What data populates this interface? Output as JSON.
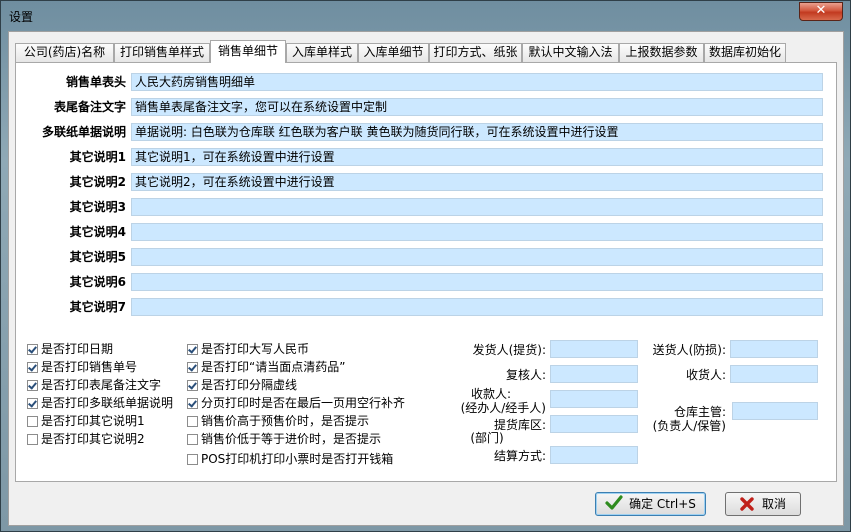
{
  "window": {
    "title": "设置",
    "close_glyph": "✕"
  },
  "tabs": [
    {
      "label": "公司(药店)名称"
    },
    {
      "label": "打印销售单样式"
    },
    {
      "label": "销售单细节"
    },
    {
      "label": "入库单样式"
    },
    {
      "label": "入库单细节"
    },
    {
      "label": "打印方式、纸张"
    },
    {
      "label": "默认中文输入法"
    },
    {
      "label": "上报数据参数"
    },
    {
      "label": "数据库初始化"
    }
  ],
  "fields": [
    {
      "label": "销售单表头",
      "value": "人民大药房销售明细单"
    },
    {
      "label": "表尾备注文字",
      "value": "销售单表尾备注文字，您可以在系统设置中定制"
    },
    {
      "label": "多联纸单据说明",
      "value": "单据说明: 白色联为仓库联       红色联为客户联       黄色联为随货同行联，可在系统设置中进行设置"
    },
    {
      "label": "其它说明1",
      "value": "其它说明1，可在系统设置中进行设置"
    },
    {
      "label": "其它说明2",
      "value": "其它说明2，可在系统设置中进行设置"
    },
    {
      "label": "其它说明3",
      "value": ""
    },
    {
      "label": "其它说明4",
      "value": ""
    },
    {
      "label": "其它说明5",
      "value": ""
    },
    {
      "label": "其它说明6",
      "value": ""
    },
    {
      "label": "其它说明7",
      "value": ""
    }
  ],
  "checks_col1": [
    {
      "label": "是否打印日期",
      "checked": true
    },
    {
      "label": "是否打印销售单号",
      "checked": true
    },
    {
      "label": "是否打印表尾备注文字",
      "checked": true
    },
    {
      "label": "是否打印多联纸单据说明",
      "checked": true
    },
    {
      "label": "是否打印其它说明1",
      "checked": false
    },
    {
      "label": "是否打印其它说明2",
      "checked": false
    }
  ],
  "checks_col2": [
    {
      "label": "是否打印大写人民币",
      "checked": true
    },
    {
      "label": "是否打印“请当面点清药品”",
      "checked": true
    },
    {
      "label": "是否打印分隔虚线",
      "checked": true
    },
    {
      "label": "分页打印时是否在最后一页用空行补齐",
      "checked": true
    },
    {
      "label": "销售价高于预售价时，是否提示",
      "checked": false
    },
    {
      "label": "销售价低于等于进价时，是否提示",
      "checked": false
    },
    {
      "label": "POS打印机打印小票时是否打开钱箱",
      "checked": false
    }
  ],
  "sign_fields": {
    "shipper": "发货人(提货):",
    "reviewer": "复核人:",
    "cashier_l1": "收款人:",
    "cashier_l2": "(经办人/经手人)",
    "pickup_l1": "提货库区:",
    "pickup_l2": "(部门)",
    "settle": "结算方式:",
    "deliverer": "送货人(防损):",
    "receiver": "收货人:",
    "warehouse_l1": "仓库主管:",
    "warehouse_l2": "(负责人/保管)"
  },
  "buttons": {
    "ok_label": "确定 Ctrl+S",
    "cancel_label": "取消"
  },
  "colors": {
    "input_bg": "#cce8ff",
    "ok_check": "#2e8b1e",
    "cancel_x": "#c0201a"
  }
}
